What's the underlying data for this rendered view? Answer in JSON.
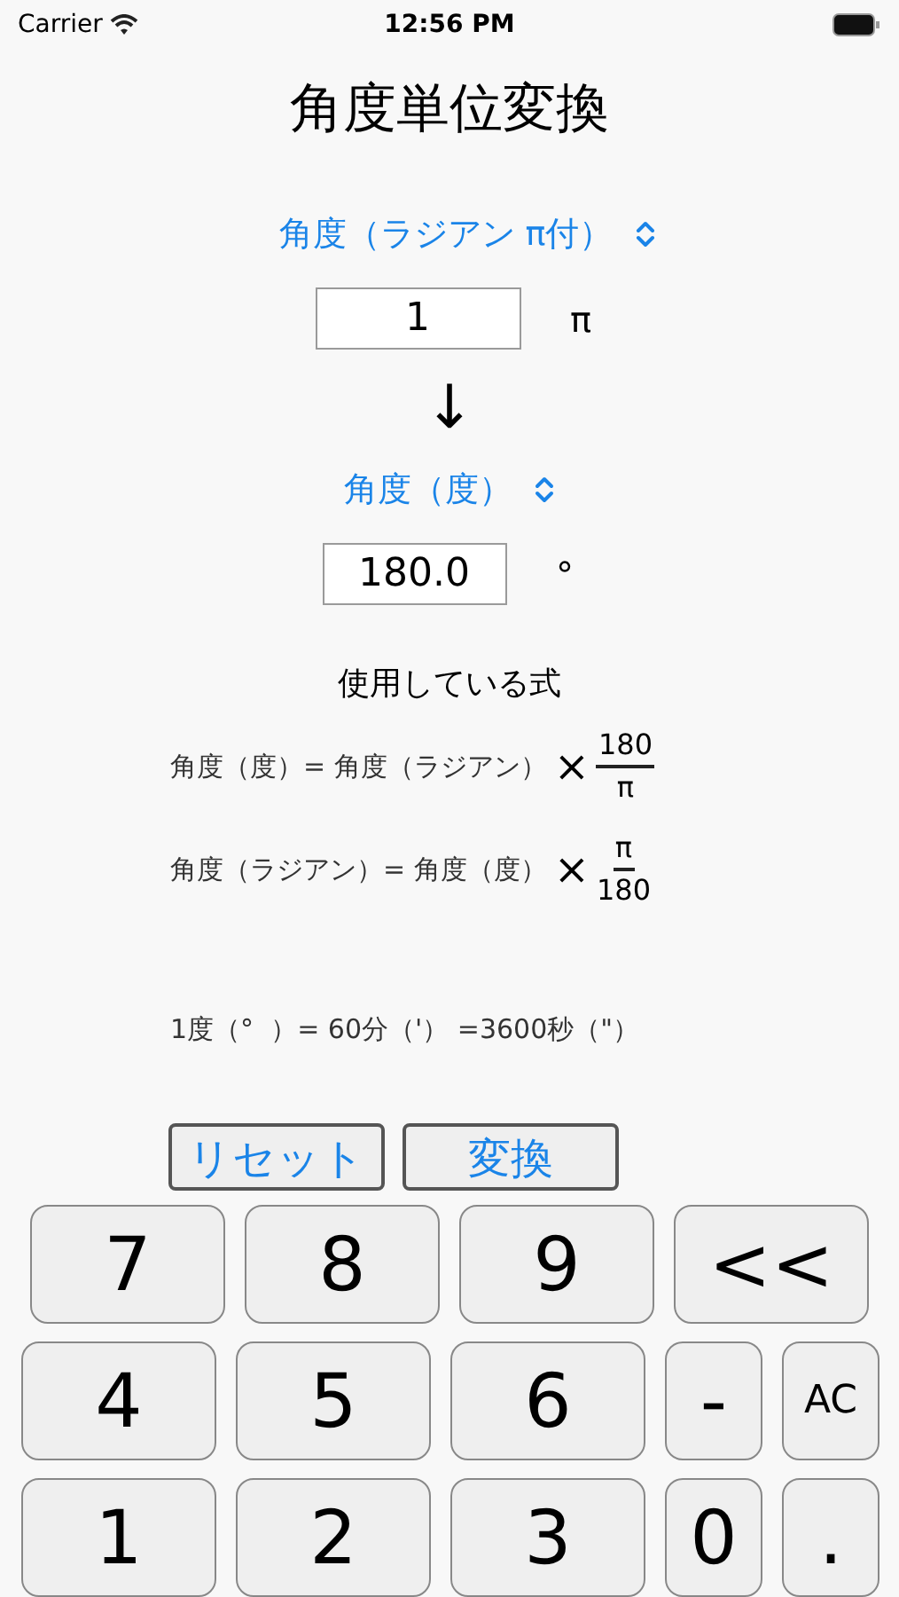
{
  "status_bar": {
    "carrier": "Carrier",
    "time": "12:56 PM"
  },
  "title": "角度単位変換",
  "from": {
    "unit_label": "角度（ラジアン π付）",
    "value": "1",
    "unit_symbol": "π"
  },
  "arrow": "↓",
  "to": {
    "unit_label": "角度（度）",
    "value": "180.0",
    "unit_symbol": "°"
  },
  "formulas_heading": "使用している式",
  "formulas": [
    {
      "lhs": "角度（度）= 角度（ラジアン）",
      "operator": "×",
      "numerator": "180",
      "denominator": "π"
    },
    {
      "lhs": "角度（ラジアン）= 角度（度）",
      "operator": "×",
      "numerator": "π",
      "denominator": "180"
    }
  ],
  "note": "1度（°  ）= 60分（'） =3600秒（\"）",
  "actions": [
    "リセット",
    "変換"
  ],
  "keypad": [
    [
      {
        "label": "7",
        "kind": "wide"
      },
      {
        "label": "8",
        "kind": "wide"
      },
      {
        "label": "9",
        "kind": "wide"
      },
      {
        "label": "<<",
        "kind": "wide"
      }
    ],
    [
      {
        "label": "4",
        "kind": "wide"
      },
      {
        "label": "5",
        "kind": "wide"
      },
      {
        "label": "6",
        "kind": "wide"
      },
      {
        "label": "-",
        "kind": "narrow"
      },
      {
        "label": "AC",
        "kind": "small"
      }
    ],
    [
      {
        "label": "1",
        "kind": "wide"
      },
      {
        "label": "2",
        "kind": "wide"
      },
      {
        "label": "3",
        "kind": "wide"
      },
      {
        "label": "0",
        "kind": "narrow"
      },
      {
        "label": ".",
        "kind": "narrow"
      }
    ]
  ]
}
